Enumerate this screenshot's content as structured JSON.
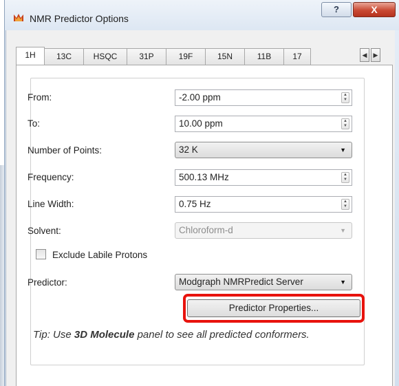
{
  "window": {
    "title": "NMR Predictor Options",
    "help_label": "?",
    "close_label": "X"
  },
  "tabs": [
    "1H",
    "13C",
    "HSQC",
    "31P",
    "19F",
    "15N",
    "11B",
    "17"
  ],
  "active_tab": "1H",
  "tab_scroll": {
    "left": "◀",
    "right": "▶"
  },
  "form": {
    "from": {
      "label": "From:",
      "value": "-2.00 ppm"
    },
    "to": {
      "label": "To:",
      "value": "10.00 ppm"
    },
    "points": {
      "label": "Number of Points:",
      "value": "32 K"
    },
    "frequency": {
      "label": "Frequency:",
      "value": "500.13 MHz"
    },
    "line_width": {
      "label": "Line Width:",
      "value": "0.75 Hz"
    },
    "solvent": {
      "label": "Solvent:",
      "value": "Chloroform-d",
      "disabled": true
    },
    "exclude_labile": {
      "label": "Exclude Labile Protons",
      "checked": false
    },
    "predictor": {
      "label": "Predictor:",
      "value": "Modgraph NMRPredict Server"
    },
    "predictor_properties_button": "Predictor Properties..."
  },
  "tip": {
    "prefix": "Tip: Use ",
    "bold": "3D Molecule",
    "suffix": " panel to see all predicted conformers."
  },
  "colors": {
    "highlight": "#e8130d",
    "close_button": "#c94a34"
  }
}
